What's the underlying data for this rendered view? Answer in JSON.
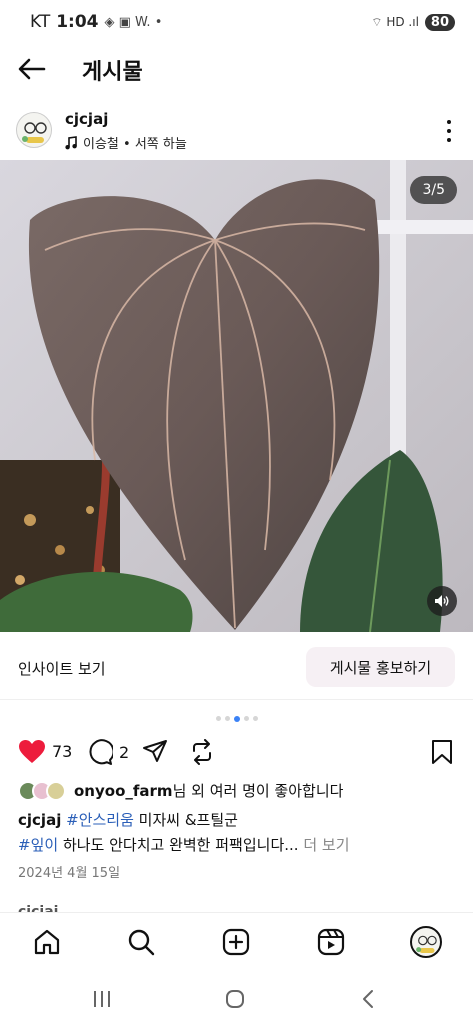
{
  "status_bar": {
    "carrier": "KT",
    "time": "1:04",
    "extra_icons": "◈ ▣ W. •",
    "right_icons": "⌔ HD .ıl",
    "battery": "80"
  },
  "header": {
    "title": "게시물"
  },
  "post": {
    "username": "cjcjaj",
    "music": "이승철 • 서쪽 하늘",
    "image_counter": "3/5",
    "insight_label": "인사이트 보기",
    "promote_label": "게시물 홍보하기",
    "carousel": {
      "count": 5,
      "active_index": 2
    },
    "like_count": "73",
    "comment_count": "2",
    "liked_by_user": "onyoo_farm",
    "liked_by_suffix": "님 외 여러 명이 좋아합니다",
    "caption": {
      "author": "cjcjaj",
      "tag1": "#안스리움",
      "text1": " 미자씨 &프틸군",
      "tag2": "#잎이",
      "text2": " 하나도 안다치고 완벽한 퍼팩입니다...",
      "more": " 더 보기"
    },
    "date": "2024년 4월 15일"
  },
  "next_post": {
    "username": "cjcjaj"
  },
  "colors": {
    "like_red": "#ed1c3c",
    "hashtag_blue": "#2b5fb8",
    "promote_bg": "#f6f0f4",
    "dot_active": "#3b82f6"
  },
  "icons": [
    "arrow-left-icon",
    "music-note-icon",
    "more-vertical-icon",
    "speaker-icon",
    "heart-icon",
    "comment-icon",
    "share-icon",
    "repost-icon",
    "bookmark-icon",
    "home-icon",
    "search-icon",
    "create-icon",
    "reels-icon",
    "recent-apps-icon",
    "home-circle-icon",
    "back-chevron-icon"
  ]
}
